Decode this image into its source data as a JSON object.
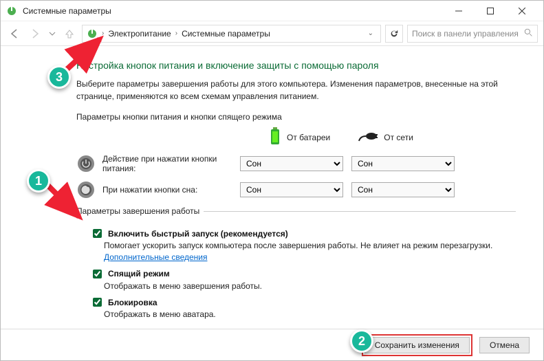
{
  "window": {
    "title": "Системные параметры"
  },
  "nav": {
    "breadcrumb": {
      "item1": "Электропитание",
      "item2": "Системные параметры"
    },
    "dropdown_glyph": "⌄",
    "search_placeholder": "Поиск в панели управления"
  },
  "page": {
    "heading": "Настройка кнопок питания и включение защиты с помощью пароля",
    "description": "Выберите параметры завершения работы для этого компьютера. Изменения параметров, внесенные на этой странице, применяются ко всем схемам управления питанием.",
    "buttons_header": "Параметры кнопки питания и кнопки спящего режима",
    "col_battery": "От батареи",
    "col_ac": "От сети",
    "row_power_label": "Действие при нажатии кнопки питания:",
    "row_sleep_label": "При нажатии кнопки сна:",
    "select_value": "Сон",
    "shutdown_legend": "Параметры завершения работы",
    "opt1": {
      "title": "Включить быстрый запуск (рекомендуется)",
      "desc_pre": "Помогает ускорить запуск компьютера после завершения работы. Не влияет на режим перезагрузки. ",
      "link": "Дополнительные сведения"
    },
    "opt2": {
      "title": "Спящий режим",
      "desc": "Отображать в меню завершения работы."
    },
    "opt3": {
      "title": "Блокировка",
      "desc": "Отображать в меню аватара."
    }
  },
  "footer": {
    "save": "Сохранить изменения",
    "cancel": "Отмена"
  },
  "callouts": {
    "c1": "1",
    "c2": "2",
    "c3": "3"
  }
}
